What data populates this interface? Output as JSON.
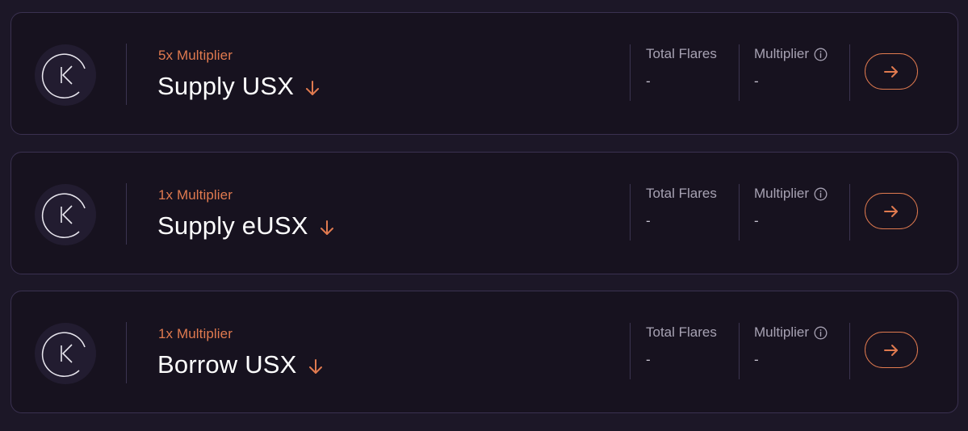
{
  "colors": {
    "accent": "#e07a4f",
    "background": "#1c1727",
    "card": "#17121f",
    "border": "#3a3150"
  },
  "cards": [
    {
      "multiplier_tag": "5x Multiplier",
      "title": "Supply USX",
      "logo_icon": "k-logo-icon",
      "total_flares_label": "Total Flares",
      "total_flares_value": "-",
      "multiplier_label": "Multiplier",
      "multiplier_value": "-"
    },
    {
      "multiplier_tag": "1x Multiplier",
      "title": "Supply eUSX",
      "logo_icon": "k-logo-icon",
      "total_flares_label": "Total Flares",
      "total_flares_value": "-",
      "multiplier_label": "Multiplier",
      "multiplier_value": "-"
    },
    {
      "multiplier_tag": "1x Multiplier",
      "title": "Borrow USX",
      "logo_icon": "k-logo-icon",
      "total_flares_label": "Total Flares",
      "total_flares_value": "-",
      "multiplier_label": "Multiplier",
      "multiplier_value": "-"
    }
  ]
}
